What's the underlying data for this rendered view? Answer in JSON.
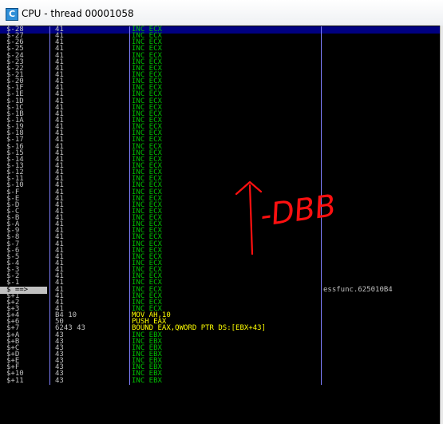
{
  "window": {
    "title": "CPU - thread 00001058",
    "icon_letter": "C"
  },
  "colors": {
    "background": "#000000",
    "address_text": "#c0c0c0",
    "hex_text": "#c0c0c0",
    "inc_instruction": "#00c000",
    "highlight_instruction": "#ffff00",
    "selection_bar": "#000080",
    "current_line_bg": "#c0c0c0",
    "annotation": "#ff0000"
  },
  "rows": [
    {
      "addr": "$-28",
      "hex": "41",
      "dis": "INC ECX",
      "color": "#00c000",
      "comment": "",
      "selected": true
    },
    {
      "addr": "$-27",
      "hex": "41",
      "dis": "INC ECX",
      "color": "#00c000",
      "comment": ""
    },
    {
      "addr": "$-26",
      "hex": "41",
      "dis": "INC ECX",
      "color": "#00c000",
      "comment": ""
    },
    {
      "addr": "$-25",
      "hex": "41",
      "dis": "INC ECX",
      "color": "#00c000",
      "comment": ""
    },
    {
      "addr": "$-24",
      "hex": "41",
      "dis": "INC ECX",
      "color": "#00c000",
      "comment": ""
    },
    {
      "addr": "$-23",
      "hex": "41",
      "dis": "INC ECX",
      "color": "#00c000",
      "comment": ""
    },
    {
      "addr": "$-22",
      "hex": "41",
      "dis": "INC ECX",
      "color": "#00c000",
      "comment": ""
    },
    {
      "addr": "$-21",
      "hex": "41",
      "dis": "INC ECX",
      "color": "#00c000",
      "comment": ""
    },
    {
      "addr": "$-20",
      "hex": "41",
      "dis": "INC ECX",
      "color": "#00c000",
      "comment": ""
    },
    {
      "addr": "$-1F",
      "hex": "41",
      "dis": "INC ECX",
      "color": "#00c000",
      "comment": ""
    },
    {
      "addr": "$-1E",
      "hex": "41",
      "dis": "INC ECX",
      "color": "#00c000",
      "comment": ""
    },
    {
      "addr": "$-1D",
      "hex": "41",
      "dis": "INC ECX",
      "color": "#00c000",
      "comment": ""
    },
    {
      "addr": "$-1C",
      "hex": "41",
      "dis": "INC ECX",
      "color": "#00c000",
      "comment": ""
    },
    {
      "addr": "$-1B",
      "hex": "41",
      "dis": "INC ECX",
      "color": "#00c000",
      "comment": ""
    },
    {
      "addr": "$-1A",
      "hex": "41",
      "dis": "INC ECX",
      "color": "#00c000",
      "comment": ""
    },
    {
      "addr": "$-19",
      "hex": "41",
      "dis": "INC ECX",
      "color": "#00c000",
      "comment": ""
    },
    {
      "addr": "$-18",
      "hex": "41",
      "dis": "INC ECX",
      "color": "#00c000",
      "comment": ""
    },
    {
      "addr": "$-17",
      "hex": "41",
      "dis": "INC ECX",
      "color": "#00c000",
      "comment": ""
    },
    {
      "addr": "$-16",
      "hex": "41",
      "dis": "INC ECX",
      "color": "#00c000",
      "comment": ""
    },
    {
      "addr": "$-15",
      "hex": "41",
      "dis": "INC ECX",
      "color": "#00c000",
      "comment": ""
    },
    {
      "addr": "$-14",
      "hex": "41",
      "dis": "INC ECX",
      "color": "#00c000",
      "comment": ""
    },
    {
      "addr": "$-13",
      "hex": "41",
      "dis": "INC ECX",
      "color": "#00c000",
      "comment": ""
    },
    {
      "addr": "$-12",
      "hex": "41",
      "dis": "INC ECX",
      "color": "#00c000",
      "comment": ""
    },
    {
      "addr": "$-11",
      "hex": "41",
      "dis": "INC ECX",
      "color": "#00c000",
      "comment": ""
    },
    {
      "addr": "$-10",
      "hex": "41",
      "dis": "INC ECX",
      "color": "#00c000",
      "comment": ""
    },
    {
      "addr": "$-F",
      "hex": "41",
      "dis": "INC ECX",
      "color": "#00c000",
      "comment": ""
    },
    {
      "addr": "$-E",
      "hex": "41",
      "dis": "INC ECX",
      "color": "#00c000",
      "comment": ""
    },
    {
      "addr": "$-D",
      "hex": "41",
      "dis": "INC ECX",
      "color": "#00c000",
      "comment": ""
    },
    {
      "addr": "$-C",
      "hex": "41",
      "dis": "INC ECX",
      "color": "#00c000",
      "comment": ""
    },
    {
      "addr": "$-B",
      "hex": "41",
      "dis": "INC ECX",
      "color": "#00c000",
      "comment": ""
    },
    {
      "addr": "$-A",
      "hex": "41",
      "dis": "INC ECX",
      "color": "#00c000",
      "comment": ""
    },
    {
      "addr": "$-9",
      "hex": "41",
      "dis": "INC ECX",
      "color": "#00c000",
      "comment": ""
    },
    {
      "addr": "$-8",
      "hex": "41",
      "dis": "INC ECX",
      "color": "#00c000",
      "comment": ""
    },
    {
      "addr": "$-7",
      "hex": "41",
      "dis": "INC ECX",
      "color": "#00c000",
      "comment": ""
    },
    {
      "addr": "$-6",
      "hex": "41",
      "dis": "INC ECX",
      "color": "#00c000",
      "comment": ""
    },
    {
      "addr": "$-5",
      "hex": "41",
      "dis": "INC ECX",
      "color": "#00c000",
      "comment": ""
    },
    {
      "addr": "$-4",
      "hex": "41",
      "dis": "INC ECX",
      "color": "#00c000",
      "comment": ""
    },
    {
      "addr": "$-3",
      "hex": "41",
      "dis": "INC ECX",
      "color": "#00c000",
      "comment": ""
    },
    {
      "addr": "$-2",
      "hex": "41",
      "dis": "INC ECX",
      "color": "#00c000",
      "comment": ""
    },
    {
      "addr": "$-1",
      "hex": "41",
      "dis": "INC ECX",
      "color": "#00c000",
      "comment": ""
    },
    {
      "addr": "$ ==>",
      "hex": "41",
      "dis": "INC ECX",
      "color": "#00c000",
      "comment": "essfunc.625010B4",
      "current": true
    },
    {
      "addr": "$+1",
      "hex": "41",
      "dis": "INC ECX",
      "color": "#00c000",
      "comment": ""
    },
    {
      "addr": "$+2",
      "hex": "41",
      "dis": "INC ECX",
      "color": "#00c000",
      "comment": ""
    },
    {
      "addr": "$+3",
      "hex": "41",
      "dis": "INC ECX",
      "color": "#00c000",
      "comment": ""
    },
    {
      "addr": "$+4",
      "hex": "B4 10",
      "dis": "MOV AH,10",
      "color": "#ffff00",
      "comment": ""
    },
    {
      "addr": "$+6",
      "hex": "50",
      "dis": "PUSH EAX",
      "color": "#ffff00",
      "comment": ""
    },
    {
      "addr": "$+7",
      "hex": "6243 43",
      "dis": "BOUND EAX,QWORD PTR DS:[EBX+43]",
      "color": "#ffff00",
      "comment": ""
    },
    {
      "addr": "$+A",
      "hex": "43",
      "dis": "INC EBX",
      "color": "#00c000",
      "comment": ""
    },
    {
      "addr": "$+B",
      "hex": "43",
      "dis": "INC EBX",
      "color": "#00c000",
      "comment": ""
    },
    {
      "addr": "$+C",
      "hex": "43",
      "dis": "INC EBX",
      "color": "#00c000",
      "comment": ""
    },
    {
      "addr": "$+D",
      "hex": "43",
      "dis": "INC EBX",
      "color": "#00c000",
      "comment": ""
    },
    {
      "addr": "$+E",
      "hex": "43",
      "dis": "INC EBX",
      "color": "#00c000",
      "comment": ""
    },
    {
      "addr": "$+F",
      "hex": "43",
      "dis": "INC EBX",
      "color": "#00c000",
      "comment": ""
    },
    {
      "addr": "$+10",
      "hex": "43",
      "dis": "INC EBX",
      "color": "#00c000",
      "comment": ""
    },
    {
      "addr": "$+11",
      "hex": "43",
      "dis": "INC EBX",
      "color": "#00c000",
      "comment": ""
    }
  ],
  "annotation": {
    "label": "-DBB",
    "arrow_icon": "up-arrow-icon"
  }
}
